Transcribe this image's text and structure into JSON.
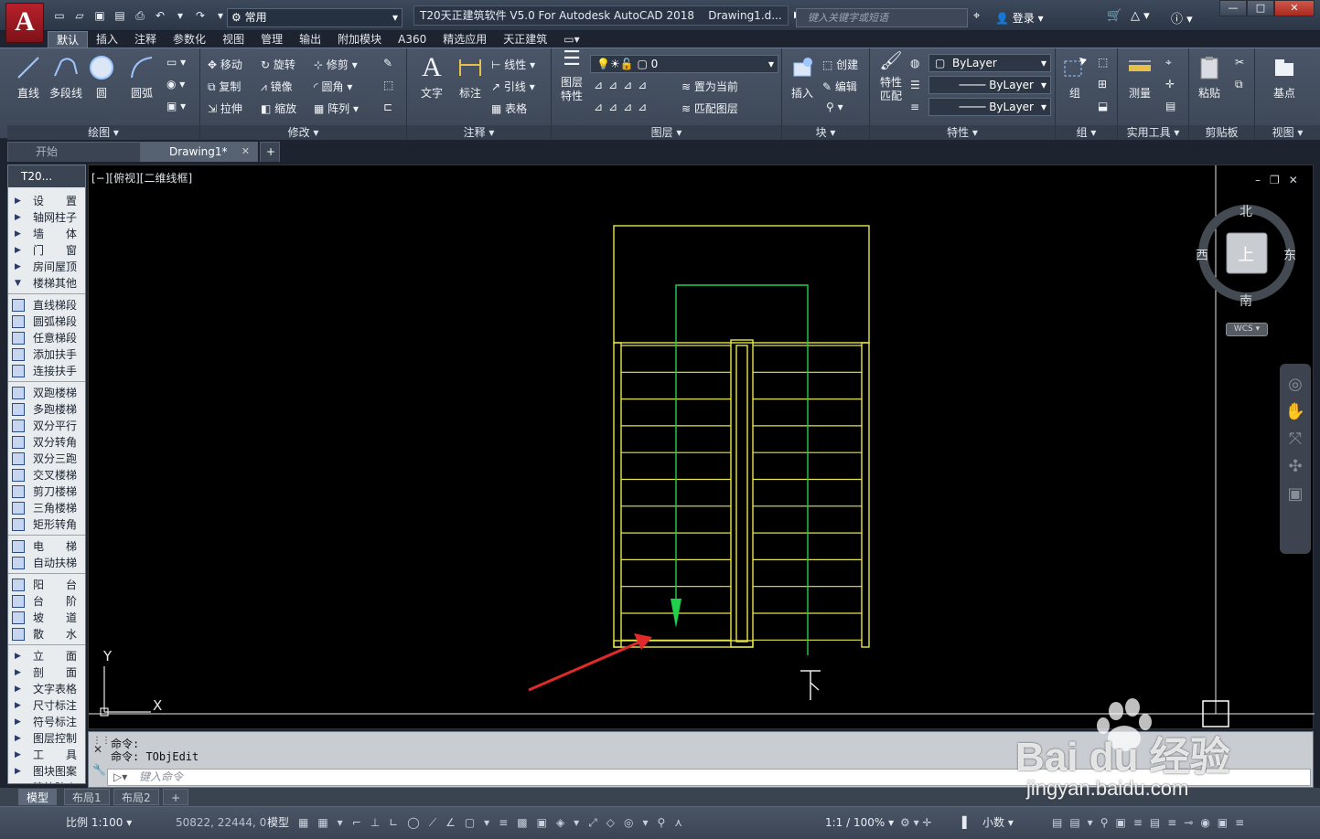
{
  "app": {
    "logo": "A",
    "workspace": "常用",
    "title": "T20天正建筑软件 V5.0 For Autodesk AutoCAD 2018",
    "file_tab": "Drawing1.d...",
    "search_placeholder": "键入关键字或短语",
    "login": "登录",
    "win_min": "—",
    "win_max": "□",
    "win_close": "✕"
  },
  "tabs": [
    "默认",
    "插入",
    "注释",
    "参数化",
    "视图",
    "管理",
    "输出",
    "附加模块",
    "A360",
    "精选应用",
    "天正建筑"
  ],
  "ribbon": {
    "draw": {
      "label": "绘图 ▾",
      "line": "直线",
      "polyline": "多段线",
      "circle": "圆",
      "arc": "圆弧"
    },
    "modify": {
      "label": "修改 ▾",
      "move": "移动",
      "rotate": "旋转",
      "trim": "修剪",
      "copy": "复制",
      "mirror": "镜像",
      "fillet": "圆角",
      "stretch": "拉伸",
      "scale": "缩放",
      "array": "阵列"
    },
    "annotation": {
      "label": "注释 ▾",
      "text": "文字",
      "dim": "标注",
      "linear": "线性",
      "leader": "引线",
      "table": "表格"
    },
    "layers": {
      "label": "图层 ▾",
      "props": "图层\n特性",
      "layer_value": "0",
      "set_current": "置为当前",
      "match": "匹配图层"
    },
    "block": {
      "label": "块 ▾",
      "insert": "插入",
      "create": "创建",
      "edit": "编辑"
    },
    "properties": {
      "label": "特性 ▾",
      "match": "特性\n匹配",
      "color": "ByLayer",
      "linetype": "ByLayer",
      "lineweight": "ByLayer"
    },
    "groups": {
      "label": "组 ▾",
      "group": "组"
    },
    "utilities": {
      "label": "实用工具 ▾",
      "measure": "测量"
    },
    "clipboard": {
      "label": "剪贴板",
      "paste": "粘贴"
    },
    "view": {
      "label": "视图 ▾",
      "base": "基点"
    }
  },
  "doctabs": {
    "start": "开始",
    "drawing": "Drawing1*",
    "close": "✕",
    "add": "+"
  },
  "palette": {
    "title": "T20...",
    "items": [
      {
        "label": "设　　置",
        "type": "arrow"
      },
      {
        "label": "轴网柱子",
        "type": "arrow"
      },
      {
        "label": "墙　　体",
        "type": "arrow"
      },
      {
        "label": "门　　窗",
        "type": "arrow"
      },
      {
        "label": "房间屋顶",
        "type": "arrow"
      },
      {
        "label": "楼梯其他",
        "type": "open"
      },
      {
        "label": "直线梯段",
        "type": "icon"
      },
      {
        "label": "圆弧梯段",
        "type": "icon"
      },
      {
        "label": "任意梯段",
        "type": "icon"
      },
      {
        "label": "添加扶手",
        "type": "icon"
      },
      {
        "label": "连接扶手",
        "type": "icon"
      },
      {
        "label": "双跑楼梯",
        "type": "icon"
      },
      {
        "label": "多跑楼梯",
        "type": "icon"
      },
      {
        "label": "双分平行",
        "type": "icon"
      },
      {
        "label": "双分转角",
        "type": "icon"
      },
      {
        "label": "双分三跑",
        "type": "icon"
      },
      {
        "label": "交叉楼梯",
        "type": "icon"
      },
      {
        "label": "剪刀楼梯",
        "type": "icon"
      },
      {
        "label": "三角楼梯",
        "type": "icon"
      },
      {
        "label": "矩形转角",
        "type": "icon"
      },
      {
        "label": "电　　梯",
        "type": "icon"
      },
      {
        "label": "自动扶梯",
        "type": "icon"
      },
      {
        "label": "阳　　台",
        "type": "icon"
      },
      {
        "label": "台　　阶",
        "type": "icon"
      },
      {
        "label": "坡　　道",
        "type": "icon"
      },
      {
        "label": "散　　水",
        "type": "icon"
      },
      {
        "label": "立　　面",
        "type": "arrow"
      },
      {
        "label": "剖　　面",
        "type": "arrow"
      },
      {
        "label": "文字表格",
        "type": "arrow"
      },
      {
        "label": "尺寸标注",
        "type": "arrow"
      },
      {
        "label": "符号标注",
        "type": "arrow"
      },
      {
        "label": "图层控制",
        "type": "arrow"
      },
      {
        "label": "工　　具",
        "type": "arrow"
      },
      {
        "label": "图块图案",
        "type": "arrow"
      },
      {
        "label": "建筑防火",
        "type": "arrow"
      }
    ]
  },
  "viewport": {
    "label": "[−][俯视][二维线框]",
    "ctrl_min": "–",
    "ctrl_max": "❐",
    "ctrl_close": "✕",
    "compass": {
      "n": "北",
      "s": "南",
      "e": "东",
      "w": "西",
      "center": "上",
      "wcs": "WCS ▾"
    },
    "ucs_x": "X",
    "ucs_y": "Y",
    "stair_label": "下"
  },
  "command": {
    "line1": "命令:",
    "line2": "命令: TObjEdit",
    "placeholder": "键入命令"
  },
  "layouts": [
    "模型",
    "布局1",
    "布局2",
    "+"
  ],
  "status": {
    "scale": "比例 1:100 ▾",
    "coords": "50822, 22444, 0",
    "model": "模型",
    "annoscale": "1:1 / 100% ▾",
    "units": "小数"
  },
  "watermark": {
    "brand": "Bai du 经验",
    "url": "jingyan.baidu.com"
  },
  "colors": {
    "stair": "#e6e64a",
    "arrow": "#22d14a",
    "pointer": "#e02a2a",
    "canvas": "#000000"
  }
}
